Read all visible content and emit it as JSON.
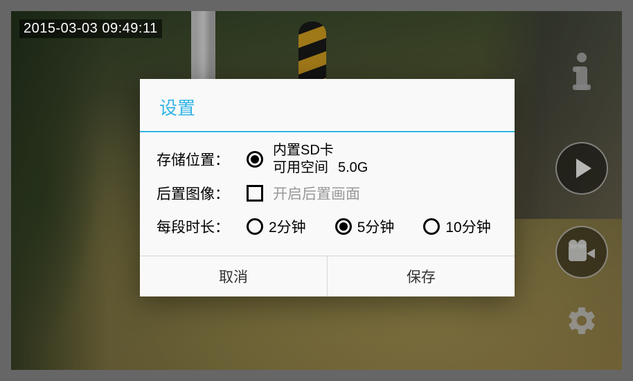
{
  "timestamp": "2015-03-03 09:49:11",
  "dialog": {
    "title": "设置",
    "storage": {
      "label": "存储位置：",
      "option_label": "内置SD卡",
      "available_label": "可用空间",
      "available_value": "5.0G",
      "selected": true
    },
    "rear_image": {
      "label": "后置图像：",
      "checkbox_label": "开启后置画面",
      "checked": false
    },
    "duration": {
      "label": "每段时长：",
      "options": [
        {
          "label": "2分钟",
          "selected": false
        },
        {
          "label": "5分钟",
          "selected": true
        },
        {
          "label": "10分钟",
          "selected": false
        }
      ]
    },
    "buttons": {
      "cancel": "取消",
      "save": "保存"
    }
  }
}
